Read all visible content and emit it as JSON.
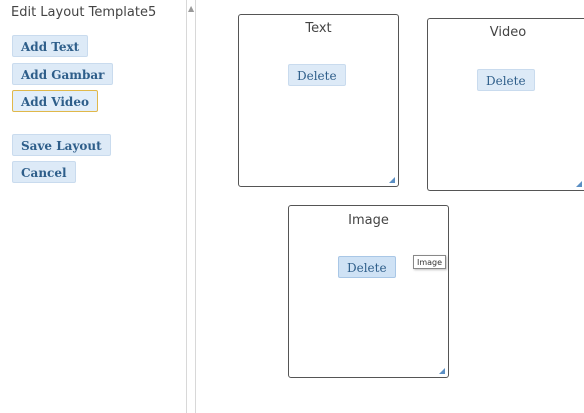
{
  "sidebar": {
    "title": "Edit Layout Template5",
    "buttons": {
      "add_text": "Add Text",
      "add_gambar": "Add Gambar",
      "add_video": "Add Video",
      "save_layout": "Save Layout",
      "cancel": "Cancel"
    }
  },
  "canvas": {
    "boxes": {
      "text": {
        "label": "Text",
        "delete_label": "Delete"
      },
      "video": {
        "label": "Video",
        "delete_label": "Delete"
      },
      "image": {
        "label": "Image",
        "delete_label": "Delete",
        "tooltip": "Image"
      }
    }
  },
  "colors": {
    "button_bg": "#ddeaf7",
    "button_text": "#2e5e8a",
    "focus_border": "#e0b84a",
    "box_border": "#555555",
    "resize_handle": "#5b8fc4"
  },
  "icons": [
    "scroll-up-arrow-icon",
    "resize-handle-icon"
  ]
}
